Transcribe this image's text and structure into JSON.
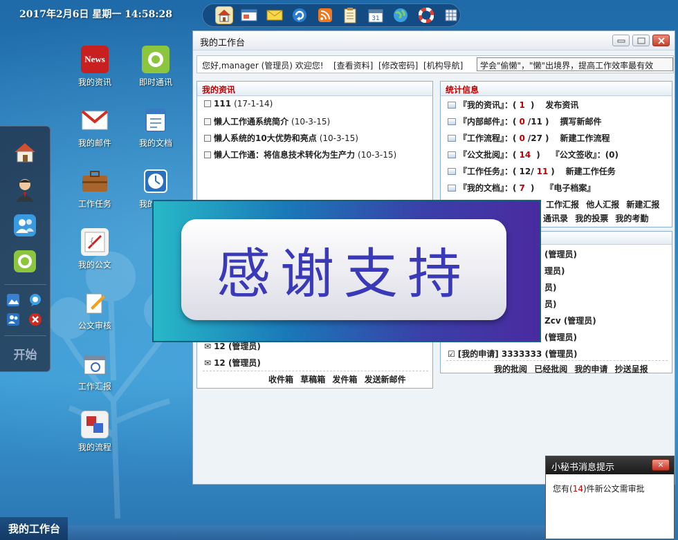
{
  "clock": "2017年2月6日 星期一 14:58:28",
  "quickbar": [
    {
      "icon": "home-icon",
      "active": true
    },
    {
      "icon": "window-icon"
    },
    {
      "icon": "mail-icon"
    },
    {
      "icon": "refresh-icon"
    },
    {
      "icon": "rss-icon"
    },
    {
      "icon": "notes-icon"
    },
    {
      "icon": "calendar-icon"
    },
    {
      "icon": "globe-icon"
    },
    {
      "icon": "lifebuoy-icon"
    },
    {
      "icon": "grid-icon"
    }
  ],
  "dock": {
    "items": [
      "home-icon",
      "user-avatar-icon",
      "contacts-icon",
      "chat-icon"
    ],
    "small": [
      "image-icon",
      "bubble-icon",
      "users-icon",
      "close-icon"
    ],
    "start": "开始"
  },
  "desktop": {
    "col1": [
      "我的资讯",
      "我的邮件",
      "工作任务",
      "我的公文",
      "公文审核",
      "工作汇报",
      "我的流程"
    ],
    "col2": [
      "即时通讯",
      "我的文档",
      "我的日程"
    ]
  },
  "window": {
    "title": "我的工作台",
    "welcome": "您好,manager (管理员) 欢迎您!",
    "links": [
      "[查看资料]",
      "[修改密码]",
      "[机构导航]"
    ],
    "slogan": "学会\"偷懒\"，\"懒\"出境界，提高工作效率最有效"
  },
  "news": {
    "title": "我的资讯",
    "items": [
      {
        "t": "111",
        "d": "(17-1-14)"
      },
      {
        "t": "懒人工作通系统简介",
        "d": "(10-3-15)"
      },
      {
        "t": "懒人系统的10大优势和亮点",
        "d": "(10-3-15)"
      },
      {
        "t": "懒人工作通：将信息技术转化为生产力",
        "d": "(10-3-15)"
      }
    ]
  },
  "mail": {
    "partial": "收件箱",
    "items": [
      "12 (管理员)",
      "12 (管理员)"
    ],
    "links": [
      "收件箱",
      "草稿箱",
      "发件箱",
      "发送新邮件"
    ]
  },
  "stats": {
    "title": "统计信息",
    "rows": [
      {
        "label": "『我的资讯』：(",
        "a": "1",
        "b": "",
        "end": ")",
        "action": "发布资讯"
      },
      {
        "label": "『内部邮件』：(",
        "a": "0",
        "b": "/11",
        "end": ")",
        "action": "撰写新邮件"
      },
      {
        "label": "『工作流程』：(",
        "a": "0",
        "b": "/27",
        "end": ")",
        "action": "新建工作流程"
      },
      {
        "label": "『公文批阅』：(",
        "a": "14",
        "b": "",
        "end": ")",
        "action": "『公文签收』：(0)"
      },
      {
        "label": "『工作任务』：(",
        "a": "12/",
        "b": "11",
        "end": ")",
        "action": "新建工作任务"
      },
      {
        "label": "『我的文档』：(",
        "a": "7",
        "b": "",
        "end": ")",
        "action": "『电子档案』"
      }
    ],
    "links1": [
      "工作汇报",
      "他人汇报",
      "新建汇报"
    ],
    "links2": [
      "通讯录",
      "我的投票",
      "我的考勤"
    ]
  },
  "approval": {
    "items": [
      "(管理员)",
      "理员)",
      "员)",
      "员)",
      "Zcv (管理员)",
      "(管理员)"
    ],
    "last": "[我的申请] 3333333 (管理员)",
    "links": [
      "我的批阅",
      "已经批阅",
      "我的申请",
      "抄送呈报"
    ]
  },
  "banner": "感谢支持",
  "taskbar": "我的工作台",
  "notice": {
    "title": "小秘书消息提示",
    "pre": "您有(",
    "count": "14",
    "post": ")件新公文需审批"
  }
}
